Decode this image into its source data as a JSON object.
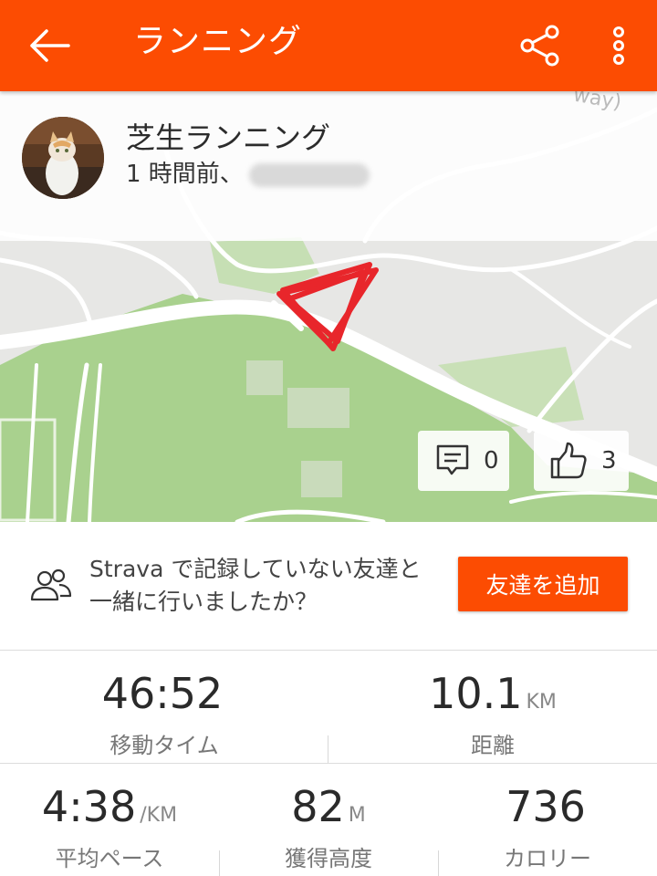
{
  "header": {
    "title": "ランニング",
    "icons": [
      "back-arrow-icon",
      "share-icon",
      "more-vertical-icon"
    ]
  },
  "activity": {
    "name": "芝生ランニング",
    "time_ago": "1 時間前、",
    "map_label": "way)",
    "comments_count": "0",
    "kudos_count": "3"
  },
  "friends_prompt": {
    "text": "Strava で記録していない友達と一緒に行いましたか？",
    "button_label": "友達を追加"
  },
  "stats": {
    "moving_time": {
      "value": "46:52",
      "unit": "",
      "label": "移動タイム"
    },
    "distance": {
      "value": "10.1",
      "unit": "KM",
      "label": "距離"
    },
    "avg_pace": {
      "value": "4:38",
      "unit": "/KM",
      "label": "平均ペース"
    },
    "elevation_gain": {
      "value": "82",
      "unit": "M",
      "label": "獲得高度"
    },
    "calories": {
      "value": "736",
      "unit": "",
      "label": "カロリー"
    }
  },
  "colors": {
    "brand": "#fc4c02",
    "route": "#e8262b",
    "park": "#a8d08d",
    "map_bg": "#e7e7e5"
  }
}
